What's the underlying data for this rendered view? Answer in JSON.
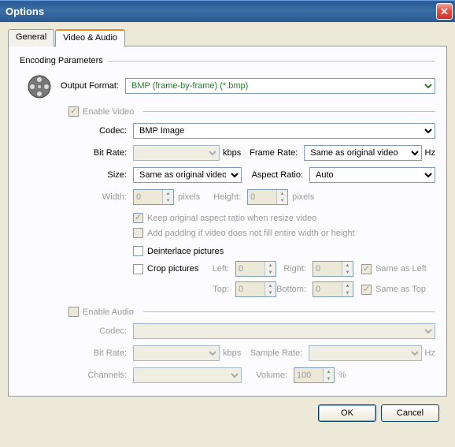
{
  "window": {
    "title": "Options"
  },
  "tabs": {
    "general": "General",
    "video_audio": "Video & Audio"
  },
  "group": {
    "encoding": "Encoding Parameters"
  },
  "video": {
    "output_format_label": "Output Format:",
    "output_format_value": "BMP (frame-by-frame) (*.bmp)",
    "enable_label": "Enable Video",
    "codec_label": "Codec:",
    "codec_value": "BMP Image",
    "bitrate_label": "Bit Rate:",
    "bitrate_unit": "kbps",
    "framerate_label": "Frame Rate:",
    "framerate_value": "Same as original video",
    "framerate_unit": "Hz",
    "size_label": "Size:",
    "size_value": "Same as original video",
    "aspect_label": "Aspect Ratio:",
    "aspect_value": "Auto",
    "width_label": "Width:",
    "width_value": "0",
    "height_label": "Height:",
    "height_value": "0",
    "pixels": "pixels",
    "keep_aspect": "Keep original aspect ratio when resize video",
    "add_padding": "Add padding if video does not fill entire width or height",
    "deinterlace": "Deinterlace pictures",
    "crop": "Crop pictures",
    "crop_left": "Left:",
    "crop_right": "Right:",
    "crop_top": "Top:",
    "crop_bottom": "Bottom:",
    "crop_val": "0",
    "same_as_left": "Same as Left",
    "same_as_top": "Same as Top"
  },
  "audio": {
    "enable_label": "Enable Audio",
    "codec_label": "Codec:",
    "bitrate_label": "Bit Rate:",
    "bitrate_unit": "kbps",
    "samplerate_label": "Sample Rate:",
    "samplerate_unit": "Hz",
    "channels_label": "Channels:",
    "volume_label": "Volume:",
    "volume_value": "100",
    "volume_unit": "%"
  },
  "buttons": {
    "ok": "OK",
    "cancel": "Cancel"
  }
}
